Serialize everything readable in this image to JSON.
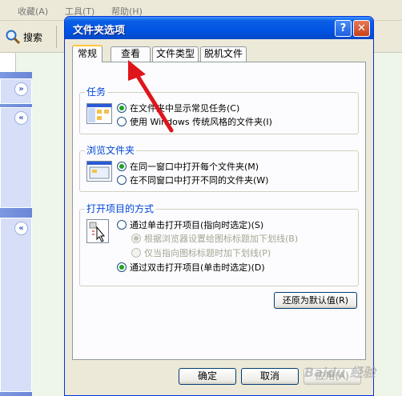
{
  "background": {
    "menu": [
      "收藏(A)",
      "工具(T)",
      "帮助(H)"
    ],
    "search_label": "搜索"
  },
  "dialog": {
    "title": "文件夹选项",
    "help": "?",
    "close": "✕",
    "tabs": [
      "常规",
      "查看",
      "文件类型",
      "脱机文件"
    ],
    "active_tab": "常规",
    "groups": [
      {
        "title": "任务",
        "options": [
          {
            "label": "在文件夹中显示常见任务(C)",
            "selected": true,
            "enabled": true
          },
          {
            "label": "使用 Windows 传统风格的文件夹(I)",
            "selected": false,
            "enabled": true
          }
        ]
      },
      {
        "title": "浏览文件夹",
        "options": [
          {
            "label": "在同一窗口中打开每个文件夹(M)",
            "selected": true,
            "enabled": true
          },
          {
            "label": "在不同窗口中打开不同的文件夹(W)",
            "selected": false,
            "enabled": true
          }
        ]
      },
      {
        "title": "打开项目的方式",
        "options": [
          {
            "label": "通过单击打开项目(指向时选定)(S)",
            "selected": false,
            "enabled": true
          },
          {
            "label": "根据浏览器设置给图标标题加下划线(B)",
            "selected": true,
            "enabled": false
          },
          {
            "label": "仅当指向图标标题时加下划线(P)",
            "selected": false,
            "enabled": false
          },
          {
            "label": "通过双击打开项目(单击时选定)(D)",
            "selected": true,
            "enabled": true
          }
        ]
      }
    ],
    "restore_defaults": "还原为默认值(R)",
    "ok": "确定",
    "cancel": "取消",
    "apply": "应用(A)"
  },
  "colors": {
    "titlebar": "#0054e3",
    "group_title": "#0046d5",
    "annotation_arrow": "#e0141b"
  }
}
